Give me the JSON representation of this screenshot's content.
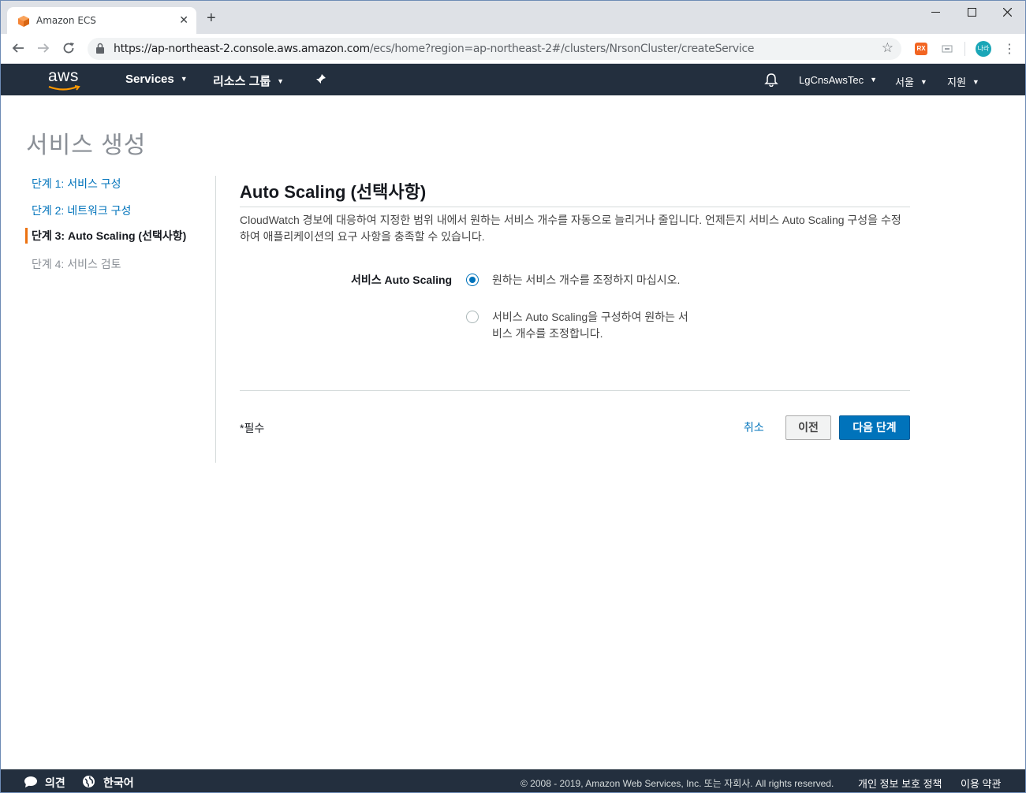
{
  "browser": {
    "tab_title": "Amazon ECS",
    "tab_close": "✕",
    "new_tab": "+",
    "url_host": "https://ap-northeast-2.console.aws.amazon.com",
    "url_path": "/ecs/home?region=ap-northeast-2#/clusters/NrsonCluster/createService",
    "ext1_label": "RX",
    "profile_label": "나라"
  },
  "awsnav": {
    "logo_text": "aws",
    "services": "Services",
    "resource_groups": "리소스 그룹",
    "account": "LgCnsAwsTec",
    "region": "서울",
    "support": "지원"
  },
  "page": {
    "title": "서비스 생성"
  },
  "steps": [
    {
      "label": "단계 1: 서비스 구성"
    },
    {
      "label": "단계 2: 네트워크 구성"
    },
    {
      "label": "단계 3: Auto Scaling (선택사항)"
    },
    {
      "label": "단계 4: 서비스 검토"
    }
  ],
  "section": {
    "title": "Auto Scaling (선택사항)",
    "description": "CloudWatch 경보에 대응하여 지정한 범위 내에서 원하는 서비스 개수를 자동으로 늘리거나 줄입니다. 언제든지 서비스 Auto Scaling 구성을 수정하여 애플리케이션의 요구 사항을 충족할 수 있습니다.",
    "field_label": "서비스 Auto Scaling",
    "options": [
      {
        "label": "원하는 서비스 개수를 조정하지 마십시오.",
        "selected": true
      },
      {
        "label": "서비스 Auto Scaling을 구성하여 원하는 서비스 개수를 조정합니다.",
        "selected": false
      }
    ]
  },
  "actions": {
    "required_note": "*필수",
    "cancel": "취소",
    "previous": "이전",
    "next": "다음 단계"
  },
  "footer": {
    "feedback": "의견",
    "language": "한국어",
    "copyright": "© 2008 - 2019, Amazon Web Services, Inc. 또는 자회사. All rights reserved.",
    "privacy": "개인 정보 보호 정책",
    "terms": "이용 약관"
  },
  "colors": {
    "aws_nav": "#232f3e",
    "link": "#0073bb",
    "primary_button": "#0073bb",
    "active_step_marker": "#ec7211"
  }
}
